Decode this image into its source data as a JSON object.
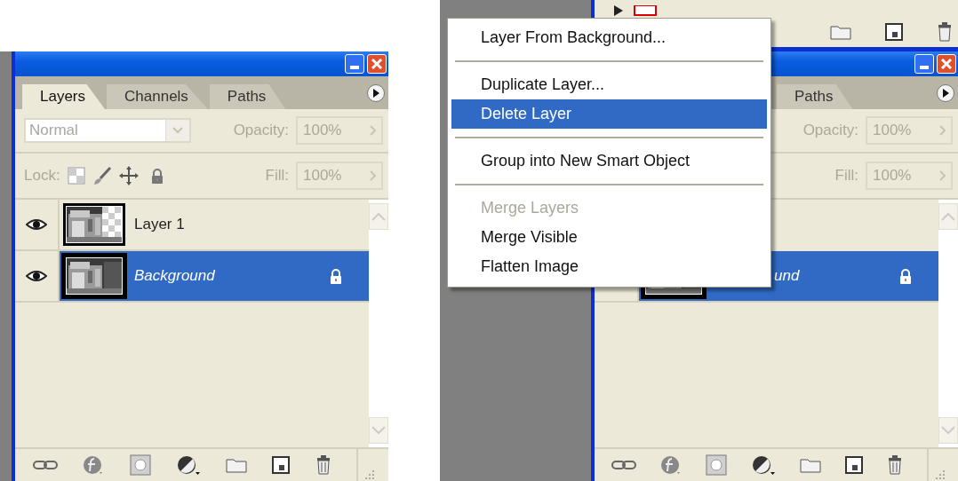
{
  "left_panel": {
    "tabs": [
      {
        "label": "Layers",
        "selected": true
      },
      {
        "label": "Channels",
        "selected": false
      },
      {
        "label": "Paths",
        "selected": false
      }
    ],
    "blend_mode": "Normal",
    "opacity_label": "Opacity:",
    "opacity": "100%",
    "lock_label": "Lock:",
    "fill_label": "Fill:",
    "fill": "100%",
    "layers": [
      {
        "kind": "layer",
        "name": "Layer 1",
        "visible": true,
        "selected": false,
        "locked": false
      },
      {
        "kind": "background",
        "name": "Background",
        "visible": true,
        "selected": true,
        "locked": true
      }
    ]
  },
  "right_panel": {
    "tabs": [
      {
        "label": "Paths",
        "selected": false
      }
    ],
    "opacity_label": "Opacity:",
    "opacity": "100%",
    "fill_label": "Fill:",
    "fill": "100%",
    "layers": [
      {
        "kind": "background",
        "name": "und",
        "selected": true,
        "locked": true
      }
    ]
  },
  "context_menu": {
    "items": [
      {
        "kind": "item",
        "label": "Layer From Background...",
        "selected": false,
        "disabled": false
      },
      {
        "kind": "separator"
      },
      {
        "kind": "item",
        "label": "Duplicate Layer...",
        "selected": false,
        "disabled": false
      },
      {
        "kind": "item",
        "label": "Delete Layer",
        "selected": true,
        "disabled": false
      },
      {
        "kind": "separator"
      },
      {
        "kind": "item",
        "label": "Group into New Smart Object",
        "selected": false,
        "disabled": false
      },
      {
        "kind": "separator"
      },
      {
        "kind": "item",
        "label": "Merge Layers",
        "selected": false,
        "disabled": true
      },
      {
        "kind": "item",
        "label": "Merge Visible",
        "selected": false,
        "disabled": false
      },
      {
        "kind": "item",
        "label": "Flatten Image",
        "selected": false,
        "disabled": false
      }
    ]
  }
}
